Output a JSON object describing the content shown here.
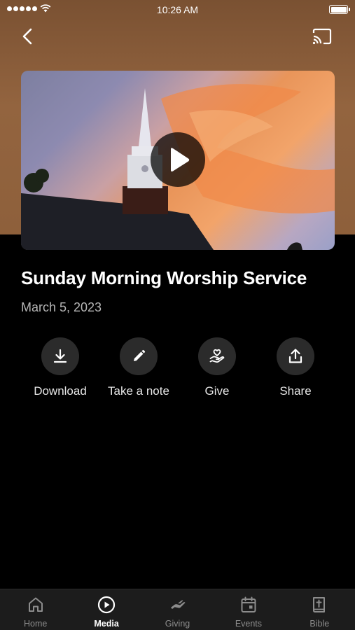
{
  "status_bar": {
    "time": "10:26 AM"
  },
  "nav": {
    "back_icon": "chevron-left-icon",
    "cast_icon": "cast-icon"
  },
  "media": {
    "title": "Sunday Morning Worship Service",
    "date": "March 5, 2023",
    "play_icon": "play-icon"
  },
  "actions": [
    {
      "label": "Download",
      "icon": "download-icon"
    },
    {
      "label": "Take a note",
      "icon": "pencil-icon"
    },
    {
      "label": "Give",
      "icon": "heart-hand-icon"
    },
    {
      "label": "Share",
      "icon": "share-icon"
    }
  ],
  "tabs": [
    {
      "label": "Home",
      "icon": "home-icon",
      "active": false
    },
    {
      "label": "Media",
      "icon": "play-circle-icon",
      "active": true
    },
    {
      "label": "Giving",
      "icon": "giving-icon",
      "active": false
    },
    {
      "label": "Events",
      "icon": "calendar-icon",
      "active": false
    },
    {
      "label": "Bible",
      "icon": "bible-icon",
      "active": false
    }
  ],
  "colors": {
    "header": "#8e603b",
    "background": "#000000",
    "tab_bar": "#1c1c1c",
    "action_circle": "#2b2b2b"
  }
}
